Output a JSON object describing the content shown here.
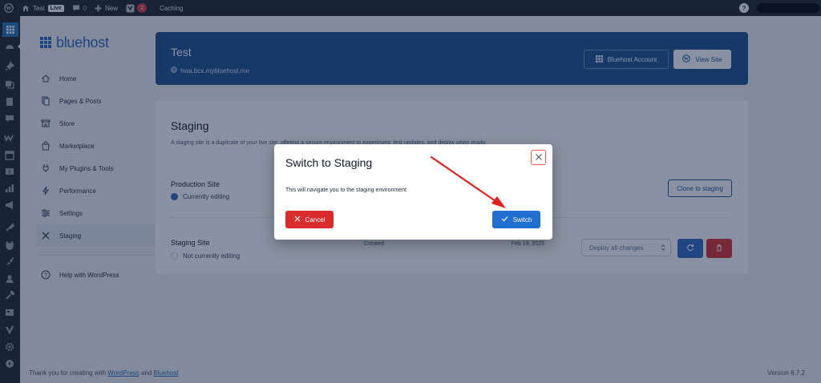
{
  "admin_bar": {
    "site_name": "Test",
    "live_badge": "Live",
    "comments_count": "0",
    "new_label": "New",
    "yoast_count": "2",
    "caching_label": "Caching",
    "help_label": "?"
  },
  "sidebar": {
    "logo_text": "bluehost",
    "items": [
      {
        "label": "Home",
        "icon": "home-icon"
      },
      {
        "label": "Pages & Posts",
        "icon": "pages-icon"
      },
      {
        "label": "Store",
        "icon": "store-icon"
      },
      {
        "label": "Marketplace",
        "icon": "bag-icon"
      },
      {
        "label": "My Plugins & Tools",
        "icon": "plug-icon"
      },
      {
        "label": "Performance",
        "icon": "bolt-icon"
      },
      {
        "label": "Settings",
        "icon": "sliders-icon"
      },
      {
        "label": "Staging",
        "icon": "tools-icon",
        "active": true
      }
    ],
    "help_label": "Help with WordPress"
  },
  "header": {
    "site_title": "Test",
    "site_url": "hwa.bcx.mybluehost.me",
    "account_button": "Bluehost Account",
    "view_site_button": "View Site"
  },
  "staging_card": {
    "title": "Staging",
    "description": "A staging site is a duplicate of your live site, offering a secure environment to experiment, test updates, and deploy when ready.",
    "production": {
      "title": "Production Site",
      "status": "Currently editing",
      "clone_button": "Clone to staging"
    },
    "staging": {
      "title": "Staging Site",
      "status": "Not currently editing",
      "created_label": "Created:",
      "created_date": "Feb 19, 2025",
      "deploy_select": "Deploy all changes"
    }
  },
  "footer": {
    "thanks_prefix": "Thank you for creating with",
    "wordpress_link": "WordPress",
    "and": "and",
    "bluehost_link": "Bluehost",
    "version": "Version 6.7.2"
  },
  "modal": {
    "title": "Switch to Staging",
    "message": "This will navigate you to the staging environment",
    "cancel_label": "Cancel",
    "switch_label": "Switch"
  },
  "colors": {
    "accent": "#1f6fd1",
    "danger": "#d92d2d",
    "annotation_arrow": "#e11d1d"
  }
}
